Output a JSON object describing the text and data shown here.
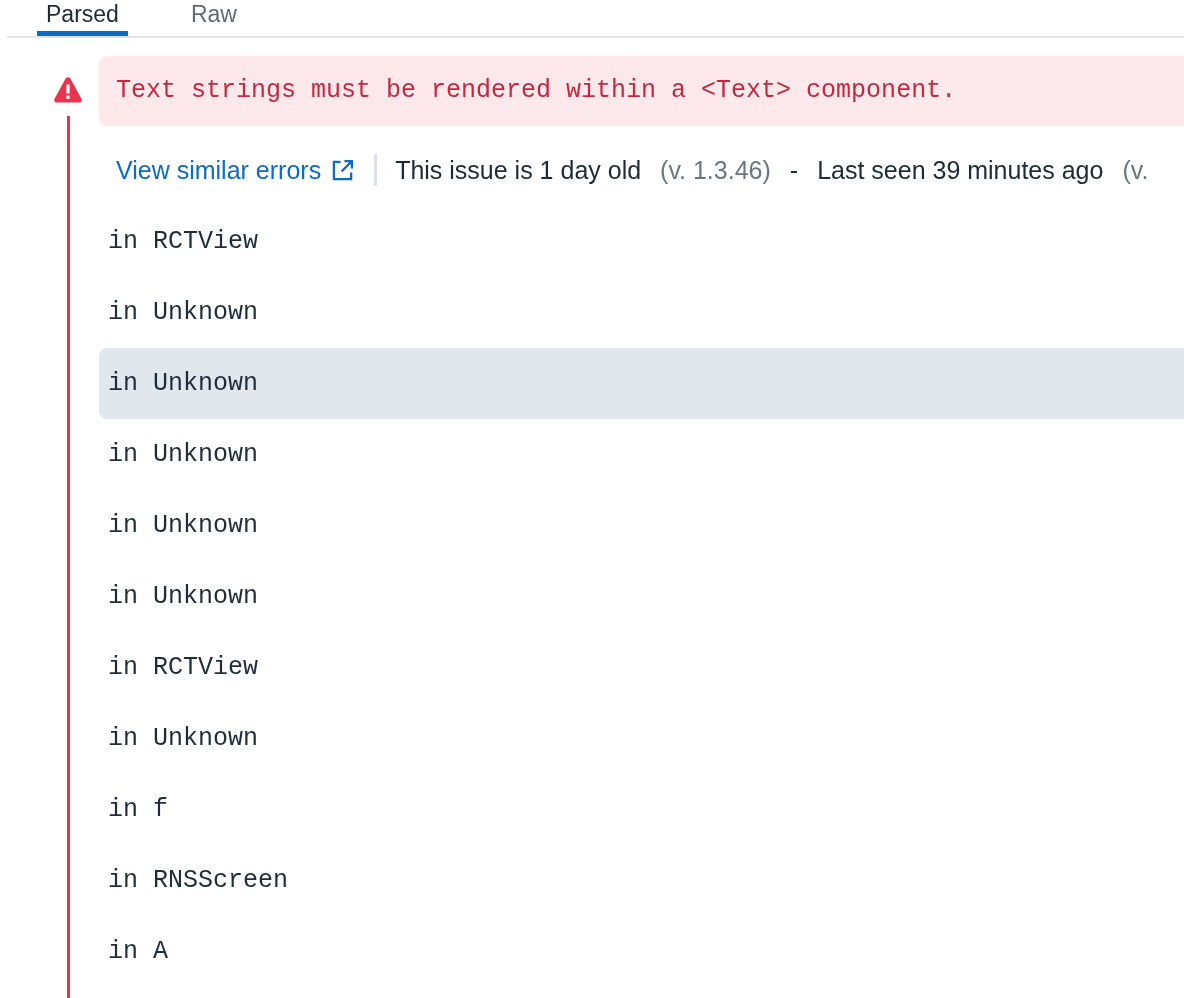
{
  "tabs": [
    {
      "label": "Parsed",
      "selected": true
    },
    {
      "label": "Raw",
      "selected": false
    }
  ],
  "error": {
    "message": "Text strings must be rendered within a <Text> component.",
    "meta": {
      "link": "View similar errors",
      "age": "This issue is 1 day old",
      "first_version": "(v. 1.3.46)",
      "separator": "-",
      "last_seen": "Last seen 39 minutes ago",
      "last_version": "(v."
    }
  },
  "stack": [
    {
      "text": "in RCTView",
      "highlighted": false
    },
    {
      "text": "in Unknown",
      "highlighted": false
    },
    {
      "text": "in Unknown",
      "highlighted": true
    },
    {
      "text": "in Unknown",
      "highlighted": false
    },
    {
      "text": "in Unknown",
      "highlighted": false
    },
    {
      "text": "in Unknown",
      "highlighted": false
    },
    {
      "text": "in RCTView",
      "highlighted": false
    },
    {
      "text": "in Unknown",
      "highlighted": false
    },
    {
      "text": "in f",
      "highlighted": false
    },
    {
      "text": "in RNSScreen",
      "highlighted": false
    },
    {
      "text": "in A",
      "highlighted": false
    }
  ]
}
